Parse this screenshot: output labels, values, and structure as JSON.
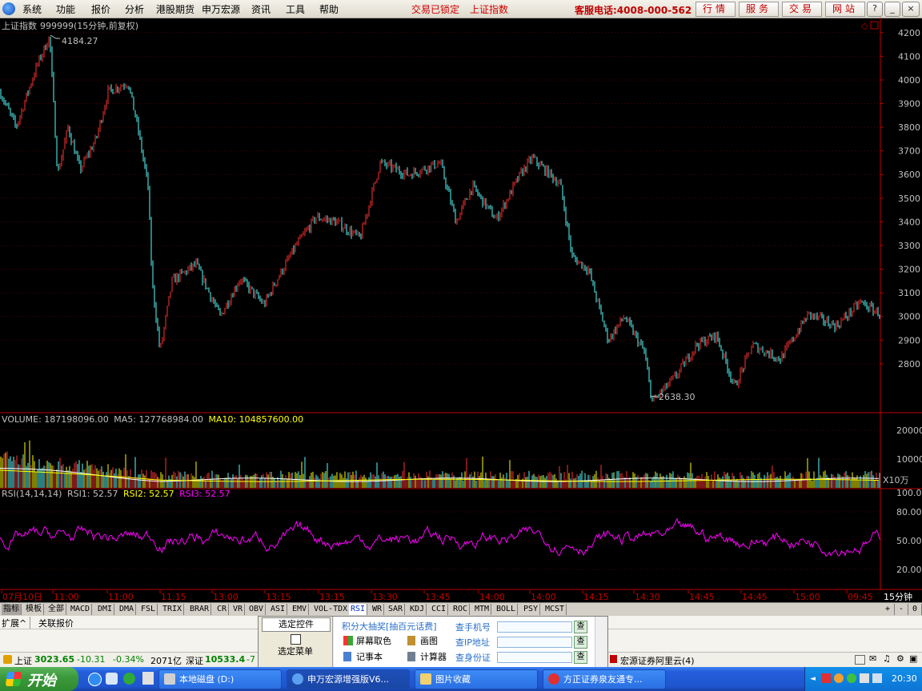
{
  "menu": [
    "系统",
    "功能",
    "报价",
    "分析",
    "港股期货",
    "申万宏源",
    "资讯",
    "工具",
    "帮助"
  ],
  "alerts": [
    "交易已锁定",
    "上证指数"
  ],
  "hotline": "客服电话:4008-000-562",
  "top_buttons": [
    "行情",
    "服务",
    "交易",
    "网站"
  ],
  "window_controls": [
    "help-icon",
    "minimize-icon",
    "restore-icon",
    "close-icon"
  ],
  "chart_header": {
    "name": "上证指数",
    "code": "999999(15分钟,前复权)"
  },
  "annotations": {
    "high": "4184.27",
    "low": "2638.30"
  },
  "volume_header": {
    "vol": "VOLUME: 187198096.00",
    "ma5": "MA5: 127768984.00",
    "ma10": "MA10: 104857600.00"
  },
  "volume_unit": "X10万",
  "rsi_header": {
    "label": "RSI(14,14,14)",
    "rsi1": "RSI1: 52.57",
    "rsi2": "RSI2: 52.57",
    "rsi3": "RSI3: 52.57"
  },
  "colors": {
    "up": "#ff3232",
    "down": "#54ffff",
    "ma5": "#ffffff",
    "ma10": "#ffff00",
    "rsi": "#ff00ff",
    "axis": "#c00000",
    "text_axis": "#c0c0c0"
  },
  "time_labels": [
    "07月10日",
    "11:00",
    "11:00",
    "11:15",
    "13:00",
    "13:15",
    "13:15",
    "13:30",
    "13:45",
    "14:00",
    "14:00",
    "14:15",
    "14:30",
    "14:45",
    "14:45",
    "15:00",
    "09:45"
  ],
  "period": "15分钟",
  "indicator_tabs": [
    "指标",
    "模板",
    "全部",
    "MACD",
    "DMI",
    "DMA",
    "FSL",
    "TRIX",
    "BRAR",
    "CR",
    "VR",
    "OBV",
    "ASI",
    "EMV",
    "VOL-TDX",
    "RSI",
    "WR",
    "SAR",
    "KDJ",
    "CCI",
    "ROC",
    "MTM",
    "BOLL",
    "PSY",
    "MCST"
  ],
  "active_tab": "RSI",
  "tab_controls": [
    "+",
    "-",
    "0"
  ],
  "ext_buttons": [
    "扩展^",
    "关联报价"
  ],
  "popup": {
    "left_items": [
      "选定控件",
      "选定菜单"
    ],
    "promo": "积分大抽奖[抽百元话费]",
    "tools": [
      "屏幕取色",
      "画图",
      "记事本",
      "计算器"
    ],
    "queries": [
      {
        "label": "查手机号",
        "btn": "查"
      },
      {
        "label": "查IP地址",
        "btn": "查"
      },
      {
        "label": "查身份证",
        "btn": "查"
      }
    ]
  },
  "status": {
    "sh_name": "上证",
    "sh_value": "3023.65",
    "sh_change": "-10.31",
    "sh_pct": "-0.34%",
    "sh_amount": "2071亿",
    "sz_name": "深证",
    "sz_value": "10533.4",
    "sz_change": "-7",
    "right_text": "宏源证券阿里云(4)"
  },
  "taskbar": {
    "start": "开始",
    "tasks": [
      "本地磁盘 (D:)",
      "申万宏源增强版V6...",
      "图片收藏",
      "方正证券泉友通专..."
    ],
    "clock": "20:30"
  },
  "chart_data": [
    {
      "type": "candlestick",
      "title": "上证指数 999999(15分钟,前复权)",
      "ylim": [
        2600,
        4250
      ],
      "yticks": [
        2800,
        2900,
        3000,
        3100,
        3200,
        3300,
        3400,
        3500,
        3600,
        3700,
        3800,
        3900,
        4000,
        4100,
        4200
      ],
      "trend": [
        [
          0,
          3950
        ],
        [
          20,
          3800
        ],
        [
          45,
          4050
        ],
        [
          62,
          4184.27
        ],
        [
          72,
          3600
        ],
        [
          85,
          3800
        ],
        [
          100,
          3620
        ],
        [
          120,
          3750
        ],
        [
          135,
          3950
        ],
        [
          160,
          3990
        ],
        [
          172,
          3800
        ],
        [
          185,
          3550
        ],
        [
          190,
          3150
        ],
        [
          200,
          2850
        ],
        [
          215,
          3150
        ],
        [
          245,
          3220
        ],
        [
          275,
          3000
        ],
        [
          300,
          3160
        ],
        [
          330,
          3050
        ],
        [
          345,
          3150
        ],
        [
          370,
          3300
        ],
        [
          395,
          3420
        ],
        [
          420,
          3400
        ],
        [
          450,
          3330
        ],
        [
          475,
          3650
        ],
        [
          510,
          3600
        ],
        [
          550,
          3650
        ],
        [
          570,
          3400
        ],
        [
          590,
          3550
        ],
        [
          620,
          3410
        ],
        [
          650,
          3600
        ],
        [
          665,
          3670
        ],
        [
          700,
          3560
        ],
        [
          715,
          3250
        ],
        [
          735,
          3200
        ],
        [
          760,
          2900
        ],
        [
          780,
          3000
        ],
        [
          805,
          2850
        ],
        [
          815,
          2638.3
        ],
        [
          845,
          2750
        ],
        [
          870,
          2880
        ],
        [
          895,
          2920
        ],
        [
          918,
          2700
        ],
        [
          940,
          2880
        ],
        [
          975,
          2820
        ],
        [
          1010,
          3010
        ],
        [
          1045,
          2960
        ],
        [
          1075,
          3060
        ],
        [
          1100,
          3010
        ]
      ]
    },
    {
      "type": "bar",
      "title": "VOLUME",
      "ylim": [
        0,
        25000
      ],
      "yticks": [
        10000,
        20000
      ],
      "unit": "X10万"
    },
    {
      "type": "line",
      "title": "RSI(14,14,14)",
      "ylim": [
        0,
        100
      ],
      "yticks": [
        20,
        50,
        80,
        100
      ],
      "series": [
        {
          "name": "RSI1",
          "last": 52.57
        },
        {
          "name": "RSI2",
          "last": 52.57
        },
        {
          "name": "RSI3",
          "last": 52.57
        }
      ]
    }
  ]
}
